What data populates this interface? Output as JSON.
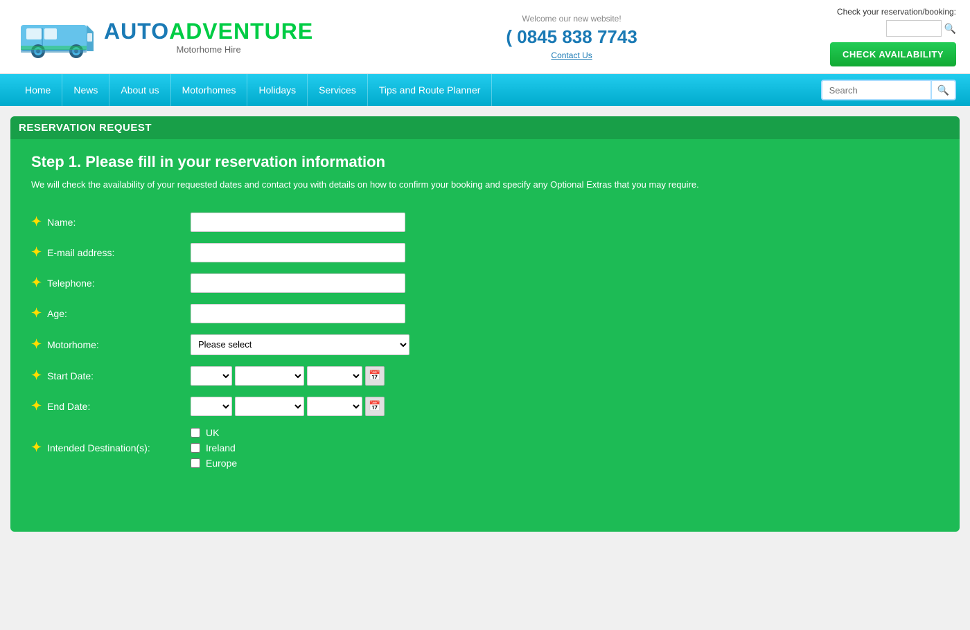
{
  "header": {
    "welcome_text": "Welcome our new website!",
    "phone": "( 0845 838 7743",
    "contact_link": "Contact Us",
    "reservation_label": "Check your reservation/booking:",
    "check_btn": "CHECK AVAILABILITY",
    "logo_auto": "AUTO",
    "logo_adventure": "ADVENTURE",
    "logo_tagline": "Motorhome Hire"
  },
  "navbar": {
    "items": [
      {
        "label": "Home"
      },
      {
        "label": "News"
      },
      {
        "label": "About us"
      },
      {
        "label": "Motorhomes"
      },
      {
        "label": "Holidays"
      },
      {
        "label": "Services"
      },
      {
        "label": "Tips and Route Planner"
      }
    ],
    "search_placeholder": "Search"
  },
  "form": {
    "section_title": "RESERVATION REQUEST",
    "step_heading": "Step 1. Please fill in your reservation information",
    "step_description": "We will check the availability of your requested dates and contact you with details on how to confirm your booking and specify any Optional Extras that you may require.",
    "fields": {
      "name_label": "Name:",
      "email_label": "E-mail address:",
      "telephone_label": "Telephone:",
      "age_label": "Age:",
      "motorhome_label": "Motorhome:",
      "motorhome_placeholder": "Please select",
      "start_date_label": "Start Date:",
      "end_date_label": "End Date:",
      "destination_label": "Intended Destination(s):"
    },
    "destinations": [
      {
        "label": "UK"
      },
      {
        "label": "Ireland"
      },
      {
        "label": "Europe"
      }
    ]
  }
}
